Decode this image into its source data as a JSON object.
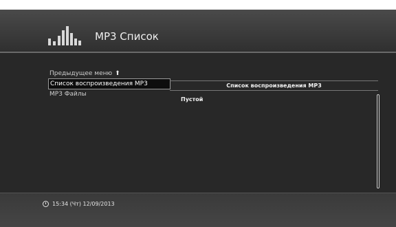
{
  "header": {
    "title": "MP3 Список",
    "logo_icon": "equalizer-bars-icon"
  },
  "menu": {
    "items": [
      {
        "label": "Предыдущее меню",
        "icon": "arrow-up-icon",
        "selected": false
      },
      {
        "label": "Список воспроизведения MP3",
        "selected": true
      },
      {
        "label": "MP3 Файлы",
        "selected": false
      }
    ]
  },
  "panel": {
    "header": "Список воспроизведения MP3",
    "empty_text": "Пустой"
  },
  "footer": {
    "clock_icon": "alarm-clock-icon",
    "datetime": "15:34 (Чт) 12/09/2013"
  }
}
